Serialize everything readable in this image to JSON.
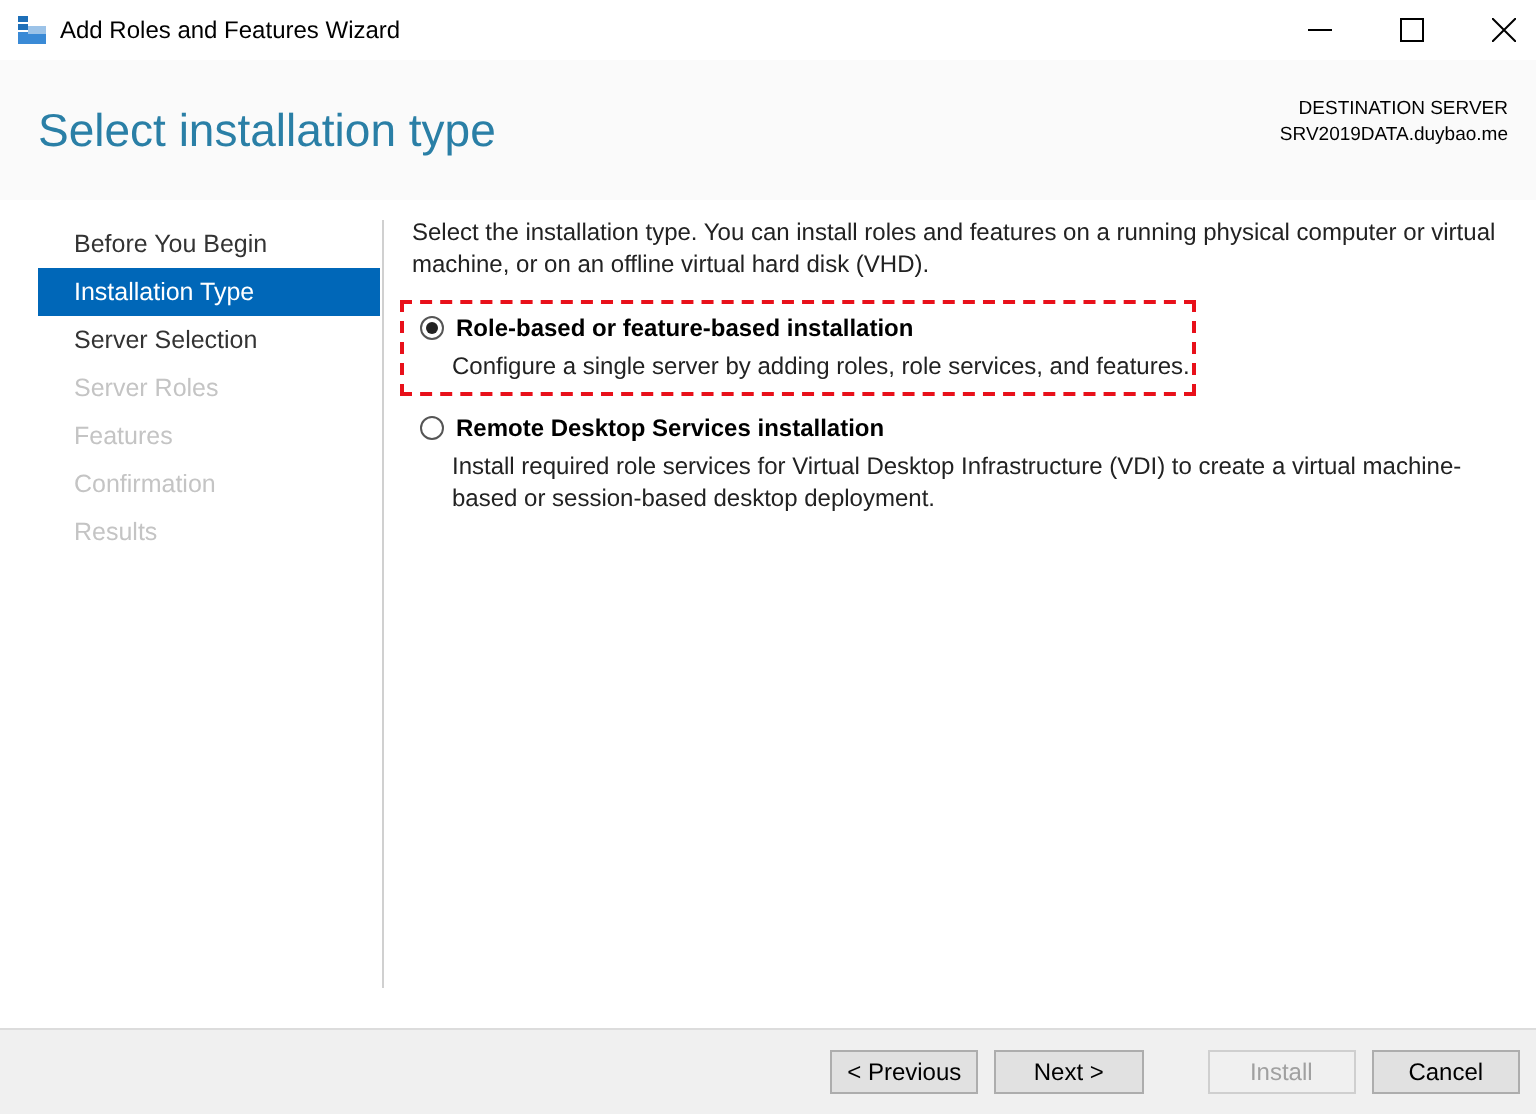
{
  "window": {
    "title": "Add Roles and Features Wizard"
  },
  "header": {
    "title": "Select installation type",
    "destination_label": "DESTINATION SERVER",
    "destination_server": "SRV2019DATA.duybao.me"
  },
  "sidebar": {
    "items": [
      {
        "label": "Before You Begin",
        "selected": false,
        "disabled": false
      },
      {
        "label": "Installation Type",
        "selected": true,
        "disabled": false
      },
      {
        "label": "Server Selection",
        "selected": false,
        "disabled": false
      },
      {
        "label": "Server Roles",
        "selected": false,
        "disabled": true
      },
      {
        "label": "Features",
        "selected": false,
        "disabled": true
      },
      {
        "label": "Confirmation",
        "selected": false,
        "disabled": true
      },
      {
        "label": "Results",
        "selected": false,
        "disabled": true
      }
    ]
  },
  "intro": "Select the installation type. You can install roles and features on a running physical computer or virtual machine, or on an offline virtual hard disk (VHD).",
  "options": [
    {
      "label": "Role-based or feature-based installation",
      "description": "Configure a single server by adding roles, role services, and features.",
      "selected": true,
      "highlighted": true
    },
    {
      "label": "Remote Desktop Services installation",
      "description": "Install required role services for Virtual Desktop Infrastructure (VDI) to create a virtual machine-based or session-based desktop deployment.",
      "selected": false,
      "highlighted": false
    }
  ],
  "buttons": [
    {
      "label": "< Previous",
      "disabled": false,
      "kind": "nav"
    },
    {
      "label": "Next >",
      "disabled": false,
      "kind": "nav"
    },
    {
      "label": "Install",
      "disabled": true,
      "kind": "action"
    },
    {
      "label": "Cancel",
      "disabled": false,
      "kind": "action"
    }
  ]
}
